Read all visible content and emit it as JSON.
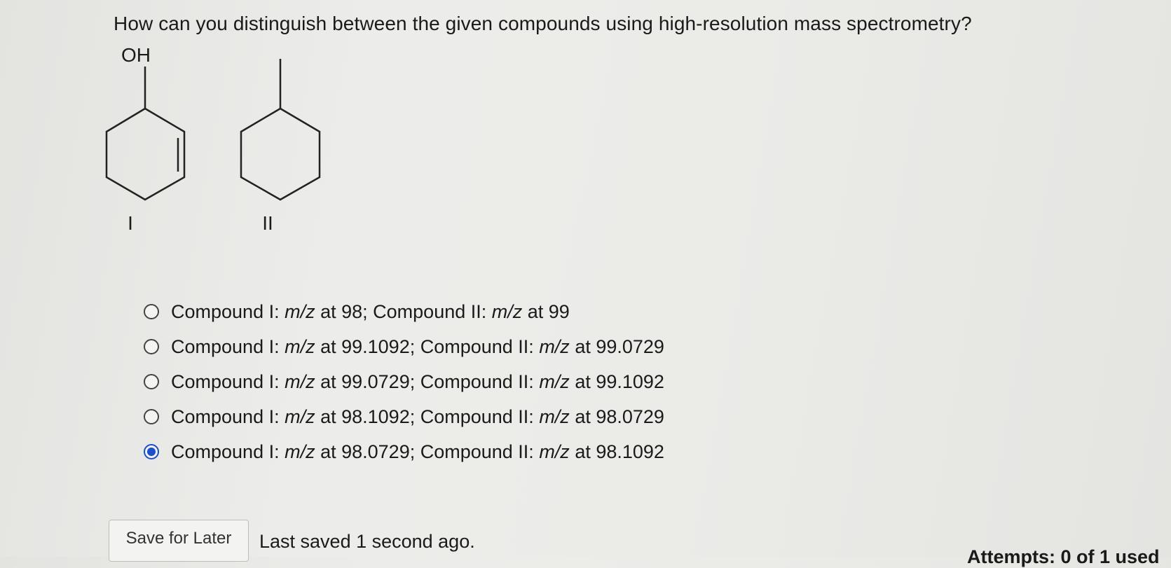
{
  "question": "How can you distinguish between the given compounds using high-resolution mass spectrometry?",
  "structures": {
    "compound_1": {
      "substituent": "OH",
      "label": "I"
    },
    "compound_2": {
      "label": "II"
    }
  },
  "options": [
    {
      "pre": "Compound I: ",
      "mz": "m/z",
      "mid": " at 98; Compound II: ",
      "mz2": "m/z",
      "post": " at 99",
      "selected": false
    },
    {
      "pre": "Compound I: ",
      "mz": "m/z",
      "mid": " at 99.1092; Compound II: ",
      "mz2": "m/z",
      "post": " at 99.0729",
      "selected": false
    },
    {
      "pre": "Compound I: ",
      "mz": "m/z",
      "mid": " at 99.0729; Compound II: ",
      "mz2": "m/z",
      "post": " at 99.1092",
      "selected": false
    },
    {
      "pre": "Compound I: ",
      "mz": "m/z",
      "mid": " at 98.1092; Compound II: ",
      "mz2": "m/z",
      "post": " at 98.0729",
      "selected": false
    },
    {
      "pre": "Compound I: ",
      "mz": "m/z",
      "mid": " at 98.0729; Compound II: ",
      "mz2": "m/z",
      "post": " at 98.1092",
      "selected": true
    }
  ],
  "footer": {
    "save_label": "Save for Later",
    "saved_status": "Last saved 1 second ago.",
    "attempts_text": "Attempts: 0 of 1 used"
  },
  "colors": {
    "radio_selected": "#1b4fd1"
  }
}
